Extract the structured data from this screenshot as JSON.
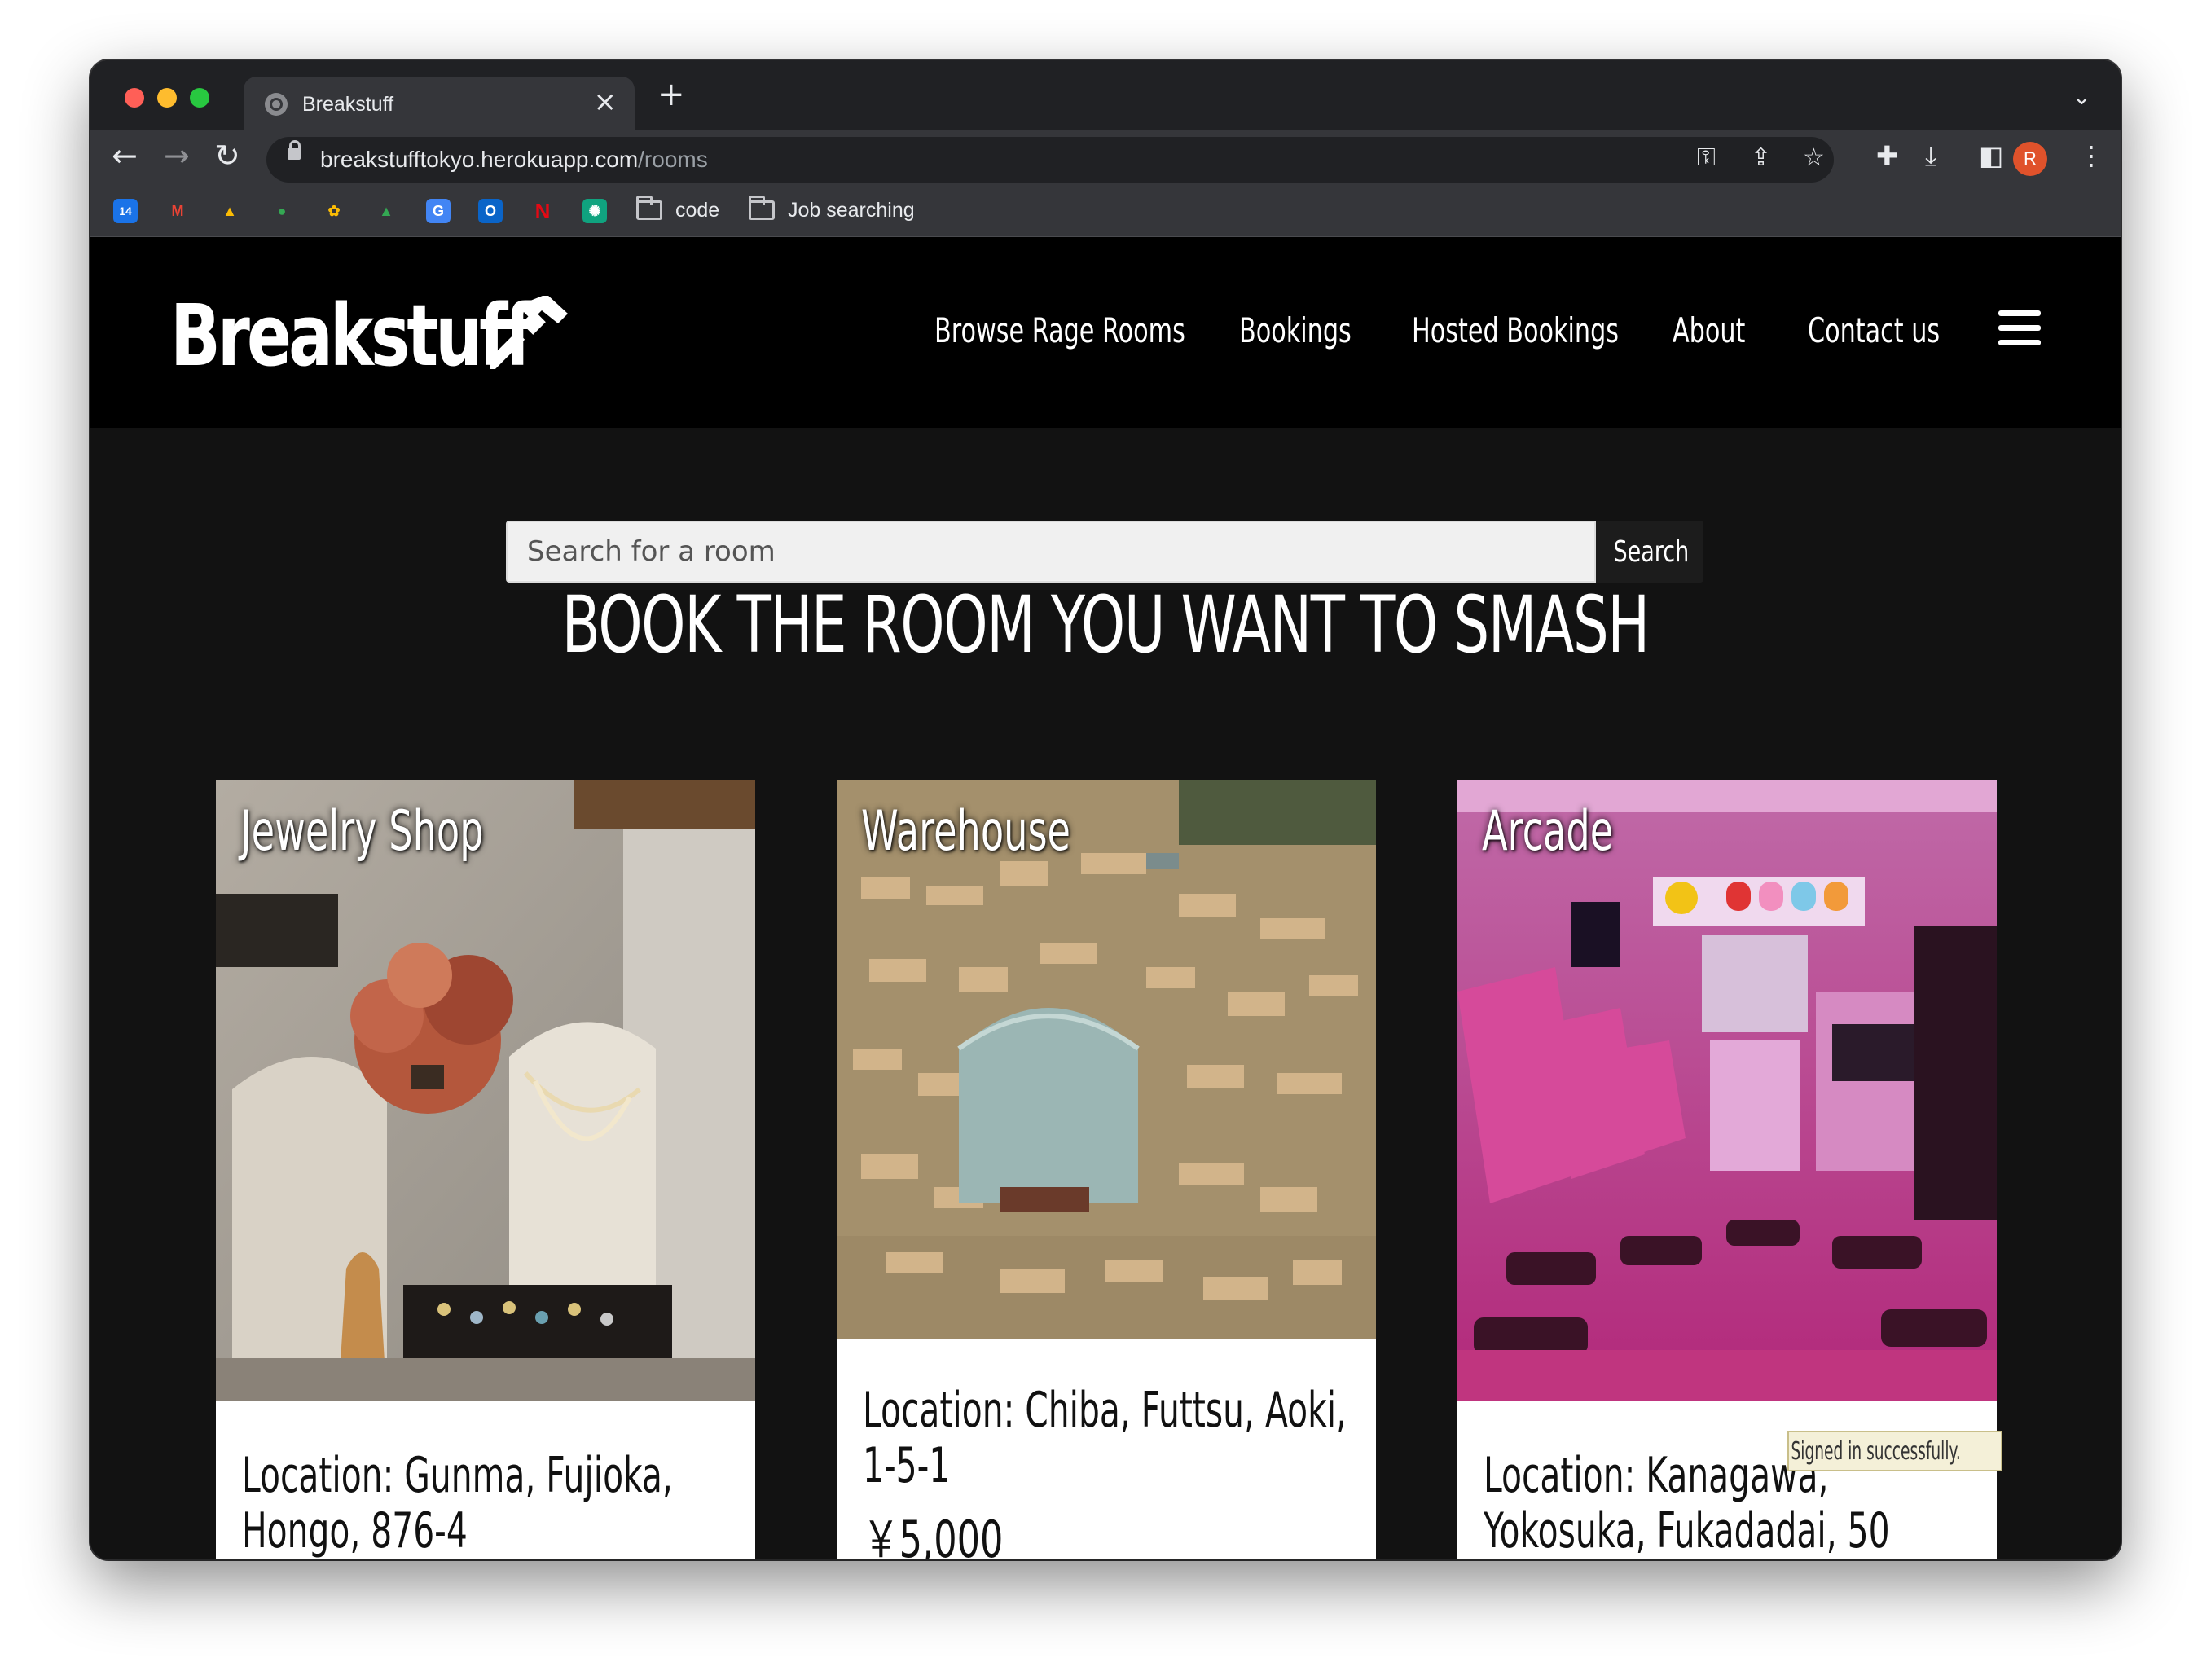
{
  "browser": {
    "tab_title": "Breakstuff",
    "tab_close": "×",
    "new_tab": "+",
    "tab_menu": "⌄",
    "url_host": "breakstufftokyo.herokuapp.com",
    "url_path": "/rooms",
    "profile_initial": "R",
    "bookmarks": [
      {
        "icon": "calendar-icon",
        "text": "14"
      },
      {
        "icon": "gmail-icon",
        "text": "M"
      },
      {
        "icon": "drive-icon",
        "text": "▲"
      },
      {
        "icon": "maps-icon",
        "text": "●"
      },
      {
        "icon": "photos-icon",
        "text": "✿"
      },
      {
        "icon": "drive-icon-2",
        "text": "▲"
      },
      {
        "icon": "translate-icon",
        "text": "G"
      },
      {
        "icon": "outlook-icon",
        "text": "O"
      },
      {
        "icon": "netflix-icon",
        "text": "N"
      },
      {
        "icon": "chatgpt-icon",
        "text": "✺"
      }
    ],
    "folders": [
      "code",
      "Job searching"
    ]
  },
  "site": {
    "logo": "Breakstuff",
    "nav": [
      "Browse Rage Rooms",
      "Bookings",
      "Hosted Bookings",
      "About",
      "Contact us"
    ],
    "search_placeholder": "Search for a room",
    "search_button": "Search",
    "heading": "BOOK THE ROOM YOU WANT TO SMASH",
    "rooms": [
      {
        "title": "Jewelry Shop",
        "location": "Location: Gunma, Fujioka, Hongo, 876-4",
        "price": ""
      },
      {
        "title": "Warehouse",
        "location": "Location: Chiba, Futtsu, Aoki, 1-5-1",
        "price": "￥5,000"
      },
      {
        "title": "Arcade",
        "location": "Location: Kanagawa, Yokosuka, Fukadadai, 50",
        "price": ""
      }
    ],
    "flash": "Signed in successfully."
  },
  "colors": {
    "header_bg": "#000000",
    "page_bg": "#121212",
    "card_bg": "#ffffff",
    "flash_bg": "#f4f0d8"
  }
}
